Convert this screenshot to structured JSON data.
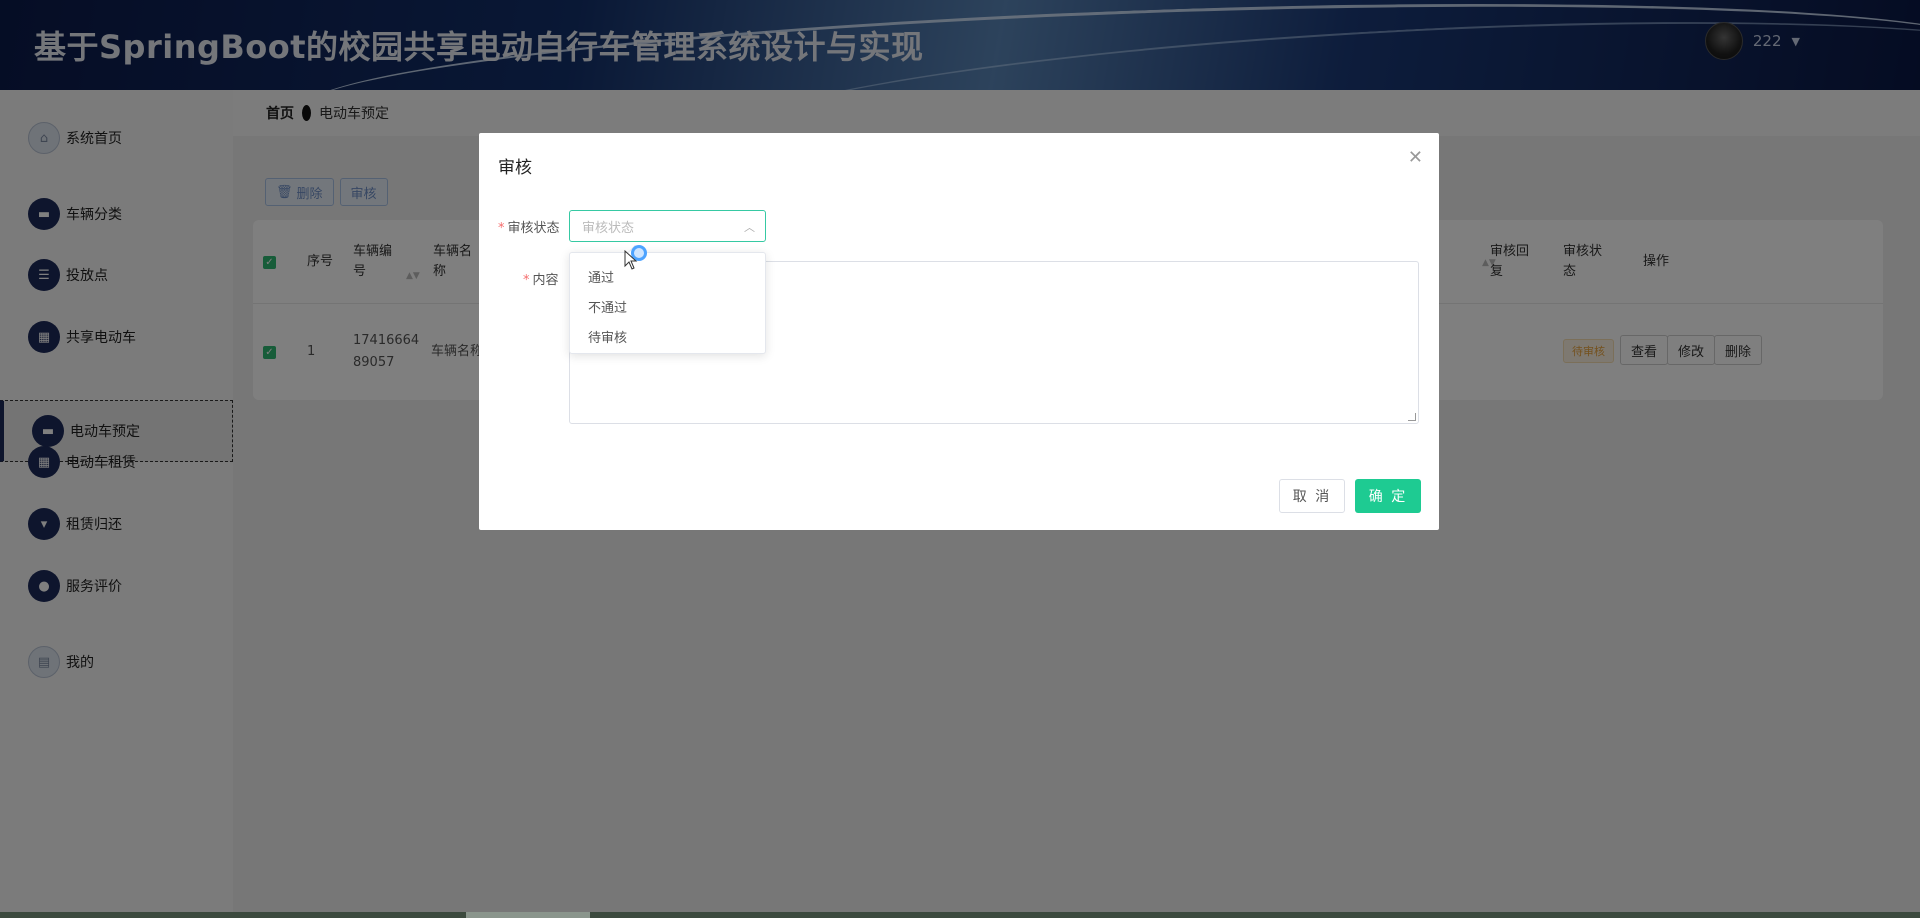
{
  "header": {
    "title": "基于SpringBoot的校园共享电动自行车管理系统设计与实现",
    "username": "222"
  },
  "sidebar": {
    "items": [
      {
        "label": "系统首页",
        "icon": "home-icon"
      },
      {
        "label": "车辆分类",
        "icon": "monitor-icon"
      },
      {
        "label": "投放点",
        "icon": "list-icon"
      },
      {
        "label": "共享电动车",
        "icon": "grid-icon"
      },
      {
        "label": "电动车预定",
        "icon": "monitor-icon",
        "active": true
      },
      {
        "label": "电动车租赁",
        "icon": "grid-icon"
      },
      {
        "label": "租赁归还",
        "icon": "pin-icon"
      },
      {
        "label": "服务评价",
        "icon": "user-icon"
      },
      {
        "label": "我的",
        "icon": "calendar-icon"
      }
    ]
  },
  "breadcrumb": {
    "home": "首页",
    "current": "电动车预定"
  },
  "toolbar": {
    "delete_label": "删除",
    "review_label": "审核"
  },
  "table": {
    "headers": [
      "序号",
      "车辆编号",
      "车辆名称",
      "审核回复",
      "审核状态",
      "操作"
    ],
    "row": {
      "index": "1",
      "vehicle_no": "1741666489057",
      "vehicle_name": "车辆名称",
      "status": "待审核"
    },
    "actions": [
      "查看",
      "修改",
      "删除"
    ]
  },
  "dialog": {
    "title": "审核",
    "status_label": "审核状态",
    "status_placeholder": "审核状态",
    "content_label": "内容",
    "options": [
      "通过",
      "不通过",
      "待审核"
    ],
    "cancel_label": "取 消",
    "ok_label": "确 定"
  }
}
